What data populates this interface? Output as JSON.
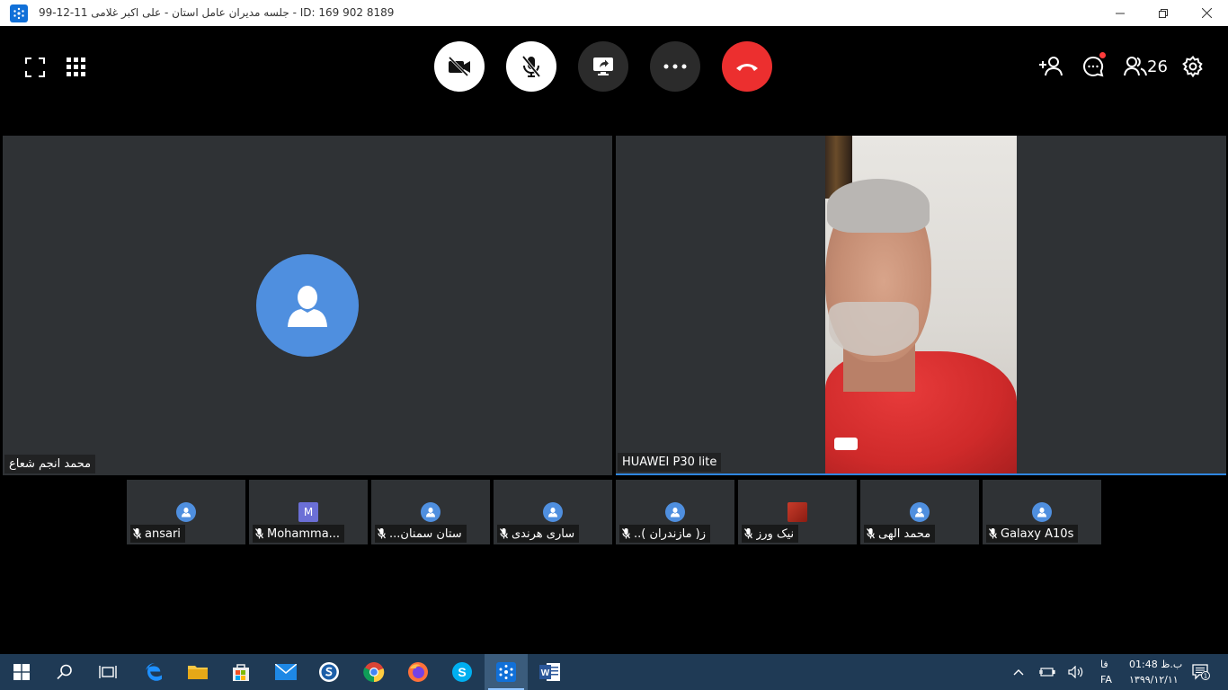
{
  "window": {
    "title": "99-12-11 جلسه مدیران عامل استان - علی اکبر غلامی - ID: 169 902 8189"
  },
  "header": {
    "participants_count": "26"
  },
  "main_tiles": [
    {
      "name": "محمد انجم شعاع"
    },
    {
      "name": "HUAWEI P30 lite"
    }
  ],
  "thumbnails": [
    {
      "name": "ansari",
      "avatar": "person-icon"
    },
    {
      "name": "Mohamma...",
      "avatar": "letter",
      "letter": "M"
    },
    {
      "name": "...ستان سمنان",
      "avatar": "person-icon"
    },
    {
      "name": "ساری هرندی",
      "avatar": "person-icon"
    },
    {
      "name": "..ز( مازندران )",
      "avatar": "person-icon"
    },
    {
      "name": "نیک ورز",
      "avatar": "photo"
    },
    {
      "name": "محمد الهی",
      "avatar": "person-icon"
    },
    {
      "name": "Galaxy A10s",
      "avatar": "person-icon"
    }
  ],
  "taskbar": {
    "clock_time": "01:48 ب.ظ",
    "clock_date": "۱۳۹۹/۱۲/۱۱",
    "lang_fa": "فا",
    "lang_code": "FA",
    "notification_count": "1"
  },
  "colors": {
    "accent_blue": "#4f8fdf",
    "hangup_red": "#ec2f2f",
    "tile_bg": "#2f3235",
    "taskbar": "#1f3a55"
  }
}
